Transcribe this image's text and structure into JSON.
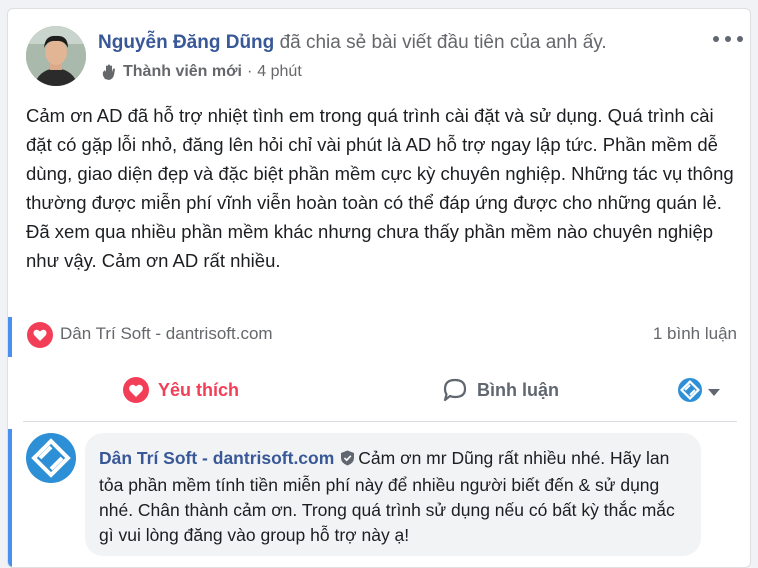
{
  "post": {
    "author": "Nguyễn Đăng Dũng",
    "action_text": "đã chia sẻ bài viết đầu tiên của anh ấy.",
    "badge": "Thành viên mới",
    "separator": "·",
    "time": "4 phút",
    "body": "Cảm ơn AD đã hỗ trợ nhiệt tình em trong quá trình cài đặt và sử dụng. Quá trình cài đặt có gặp lỗi nhỏ, đăng lên hỏi chỉ vài phút là AD hỗ trợ ngay lập tức. Phần mềm dễ dùng, giao diện đẹp và đặc biệt phần mềm cực kỳ chuyên nghiệp. Những tác vụ thông thường được miễn phí vĩnh viễn hoàn toàn có thể đáp ứng được cho những quán lẻ. Đã xem qua nhiều phần mềm khác nhưng chưa thấy phần mềm nào chuyên nghiệp như vậy. Cảm ơn AD rất nhiều."
  },
  "reactions": {
    "page_name": "Dân Trí Soft - dantrisoft.com",
    "comment_count": "1 bình luận",
    "reaction_icon": "heart-icon"
  },
  "actions": {
    "like_label": "Yêu thích",
    "comment_label": "Bình luận"
  },
  "comment": {
    "author": "Dân Trí Soft - dantrisoft.com",
    "text": "Cảm ơn mr Dũng rất nhiều nhé. Hãy lan tỏa phần mềm tính tiền miễn phí này để nhiều người biết đến & sử dụng nhé. Chân thành cảm ơn. Trong quá trình sử dụng nếu có bất kỳ thắc mắc gì vui lòng đăng vào group hỗ trợ này ạ!"
  },
  "colors": {
    "link_blue": "#385898",
    "love_red": "#f33e58",
    "accent_blue": "#4b8ff0",
    "secondary_text": "#65676b"
  }
}
